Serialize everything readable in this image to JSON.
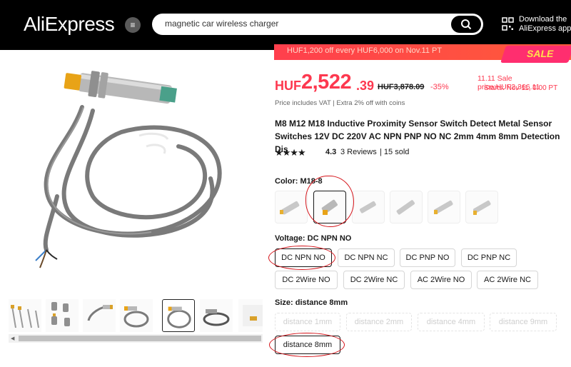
{
  "header": {
    "logo": "AliExpress",
    "search_value": "magnetic car wireless charger",
    "app_line1": "Download the",
    "app_line2": "AliExpress app"
  },
  "promo": {
    "text": "HUF1,200 off every HUF6,000 on Nov.11 PT",
    "sale": "SALE"
  },
  "price": {
    "currency": "HUF",
    "main": "2,522",
    "decimals": ".39",
    "old": "HUF3,878.09",
    "discount": "-35%",
    "sale_price": "11.11 Sale price:HUF2,366.11",
    "sale_starts": "Starts: Nov 11, 0:00 PT",
    "vat": "Price includes VAT | Extra 2% off with coins"
  },
  "product": {
    "title": "M8 M12 M18 Inductive Proximity Sensor Switch Detect Metal Sensor Switches 12V DC 220V AC NPN PNP NO NC 2mm 4mm 8mm Detection Dis",
    "stars": "★★★★",
    "rating": "4.3",
    "reviews": "3 Reviews",
    "sold": "| 15 sold"
  },
  "color": {
    "label": "Color: M18-8"
  },
  "voltage": {
    "label": "Voltage: DC NPN NO",
    "options": [
      "DC NPN NO",
      "DC NPN NC",
      "DC PNP NO",
      "DC PNP NC",
      "DC 2Wire NO",
      "DC 2Wire NC",
      "AC 2Wire NO",
      "AC 2Wire NC"
    ]
  },
  "size": {
    "label": "Size: distance 8mm",
    "options": [
      "distance 1mm",
      "distance 2mm",
      "distance 4mm",
      "distance 9mm",
      "distance 8mm"
    ]
  },
  "colors": {
    "accent": "#fd384f",
    "annotation": "#d5151b"
  }
}
